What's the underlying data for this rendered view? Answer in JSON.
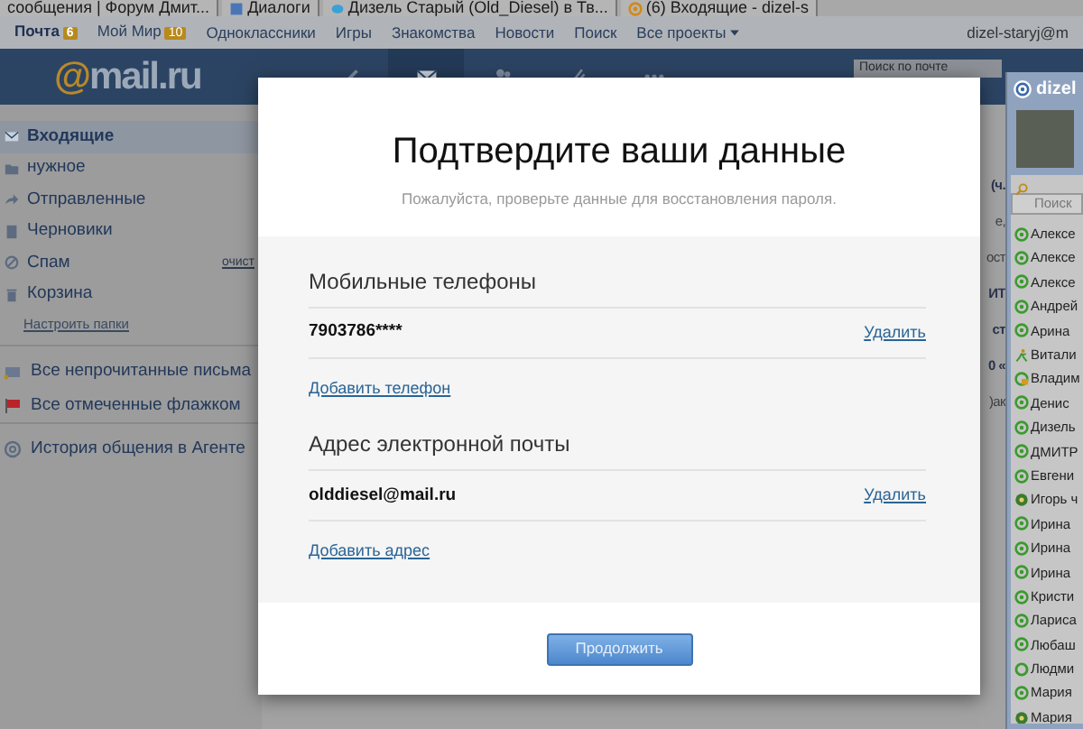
{
  "browser_tabs": [
    {
      "label": "сообщения | Форум Дмит...",
      "kind": "plain"
    },
    {
      "label": "Диалоги",
      "kind": "chat"
    },
    {
      "label": "Дизель Старый (Old_Diesel) в Тв...",
      "kind": "bird"
    },
    {
      "label": "(6) Входящие - dizel-s",
      "kind": "at"
    }
  ],
  "portal_nav": {
    "items": [
      {
        "label": "Почта",
        "badge": "6",
        "selected": true,
        "kind": "link"
      },
      {
        "label": "Мой Мир",
        "badge": "10",
        "selected": false,
        "kind": "link"
      },
      {
        "label": "Одноклассники",
        "selected": false,
        "kind": "link"
      },
      {
        "label": "Игры",
        "selected": false,
        "kind": "link"
      },
      {
        "label": "Знакомства",
        "selected": false,
        "kind": "link"
      },
      {
        "label": "Новости",
        "selected": false,
        "kind": "link"
      },
      {
        "label": "Поиск",
        "selected": false,
        "kind": "link"
      },
      {
        "label": "Все проекты",
        "selected": false,
        "kind": "dropdown"
      }
    ],
    "account": "dizel-staryj@m"
  },
  "header": {
    "logo": "@mail.ru",
    "toolbar": [
      {
        "kind": "pencil",
        "selected": false
      },
      {
        "kind": "envelope",
        "selected": true
      },
      {
        "kind": "people",
        "selected": false
      },
      {
        "kind": "clip",
        "selected": false
      },
      {
        "kind": "dots",
        "selected": false
      }
    ],
    "search": {
      "placeholder": "Поиск по почте"
    }
  },
  "sidebar": {
    "folders": [
      {
        "label": "Входящие",
        "kind": "envelope",
        "selected": true
      },
      {
        "label": "нужное",
        "kind": "folder",
        "selected": false
      },
      {
        "label": "Отправленные",
        "kind": "sent",
        "selected": false
      },
      {
        "label": "Черновики",
        "kind": "draft",
        "selected": false
      },
      {
        "label": "Спам",
        "kind": "spam",
        "selected": false,
        "action": "очист"
      },
      {
        "label": "Корзина",
        "kind": "trash",
        "selected": false
      }
    ],
    "settings_link": "Настроить папки",
    "filters": [
      {
        "label": "Все непрочитанные письма",
        "kind": "unread"
      },
      {
        "label": "Все отмеченные флажком",
        "kind": "flag"
      }
    ],
    "history_link": "История общения в Агенте"
  },
  "message_list_fragments": [
    {
      "text": "(ч.",
      "unread": true
    },
    {
      "text": "е,",
      "unread": false
    },
    {
      "text": "ост",
      "unread": false
    },
    {
      "text": "ИТ",
      "unread": true
    },
    {
      "text": "ст",
      "unread": true
    },
    {
      "text": "0 «",
      "unread": true
    },
    {
      "text": ")ак",
      "unread": false
    }
  ],
  "agent": {
    "title": "dizel",
    "search": {
      "placeholder": "Поиск"
    },
    "contacts": [
      {
        "name": "Алексе",
        "kind": "online"
      },
      {
        "name": "Алексе",
        "kind": "online"
      },
      {
        "name": "Алексе",
        "kind": "online"
      },
      {
        "name": "Андрей",
        "kind": "online"
      },
      {
        "name": "Арина",
        "kind": "online"
      },
      {
        "name": "Витали",
        "kind": "walking"
      },
      {
        "name": "Владим",
        "kind": "locked"
      },
      {
        "name": "Денис",
        "kind": "online"
      },
      {
        "name": "Дизель",
        "kind": "online"
      },
      {
        "name": "ДМИТР",
        "kind": "online"
      },
      {
        "name": "Евгени",
        "kind": "online"
      },
      {
        "name": "Игорь ч",
        "kind": "icq"
      },
      {
        "name": "Ирина",
        "kind": "online"
      },
      {
        "name": "Ирина",
        "kind": "online"
      },
      {
        "name": "Ирина",
        "kind": "online"
      },
      {
        "name": "Кристи",
        "kind": "online"
      },
      {
        "name": "Лариса",
        "kind": "online"
      },
      {
        "name": "Любаш",
        "kind": "online"
      },
      {
        "name": "Людми",
        "kind": "ring"
      },
      {
        "name": "Мария",
        "kind": "online"
      },
      {
        "name": "Мария",
        "kind": "icq"
      }
    ]
  },
  "modal": {
    "title": "Подтвердите ваши данные",
    "subtitle": "Пожалуйста, проверьте данные для восстановления пароля.",
    "sections": [
      {
        "heading": "Мобильные телефоны",
        "entries": [
          {
            "value": "7903786****",
            "action": "Удалить"
          }
        ],
        "add_link": "Добавить телефон"
      },
      {
        "heading": "Адрес электронной почты",
        "entries": [
          {
            "value": "olddiesel@mail.ru",
            "action": "Удалить"
          }
        ],
        "add_link": "Добавить адрес"
      }
    ],
    "button": "Продолжить"
  }
}
